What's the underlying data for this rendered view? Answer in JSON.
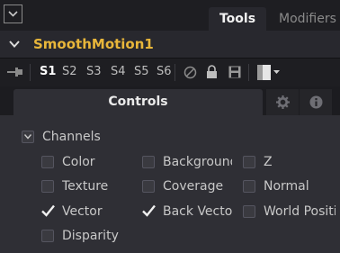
{
  "tabs": {
    "tools": "Tools",
    "modifiers": "Modifiers"
  },
  "node": {
    "name": "SmoothMotion1"
  },
  "toolbar": {
    "sets": [
      "S1",
      "S2",
      "S3",
      "S4",
      "S5",
      "S6"
    ],
    "active_set": "S1"
  },
  "controls": {
    "title": "Controls"
  },
  "channels": {
    "label": "Channels",
    "items": [
      {
        "label": "Color",
        "checked": false
      },
      {
        "label": "Background",
        "checked": false
      },
      {
        "label": "Z",
        "checked": false
      },
      {
        "label": "Texture",
        "checked": false
      },
      {
        "label": "Coverage",
        "checked": false
      },
      {
        "label": "Normal",
        "checked": false
      },
      {
        "label": "Vector",
        "checked": true
      },
      {
        "label": "Back Vector",
        "checked": true
      },
      {
        "label": "World Position",
        "checked": false
      },
      {
        "label": "Disparity",
        "checked": false
      }
    ]
  },
  "colors": {
    "node_name": "#e8b63a",
    "panel_bg": "#2f2f35",
    "toolbar_bg": "#1e1e22"
  },
  "icons": [
    "collapse-icon",
    "chevron-down-icon",
    "pin-icon",
    "disable-icon",
    "lock-icon",
    "save-icon",
    "color-swatch-icon",
    "dropdown-arrow-icon",
    "gear-icon",
    "info-icon",
    "channels-collapse-icon",
    "checkmark-icon"
  ]
}
